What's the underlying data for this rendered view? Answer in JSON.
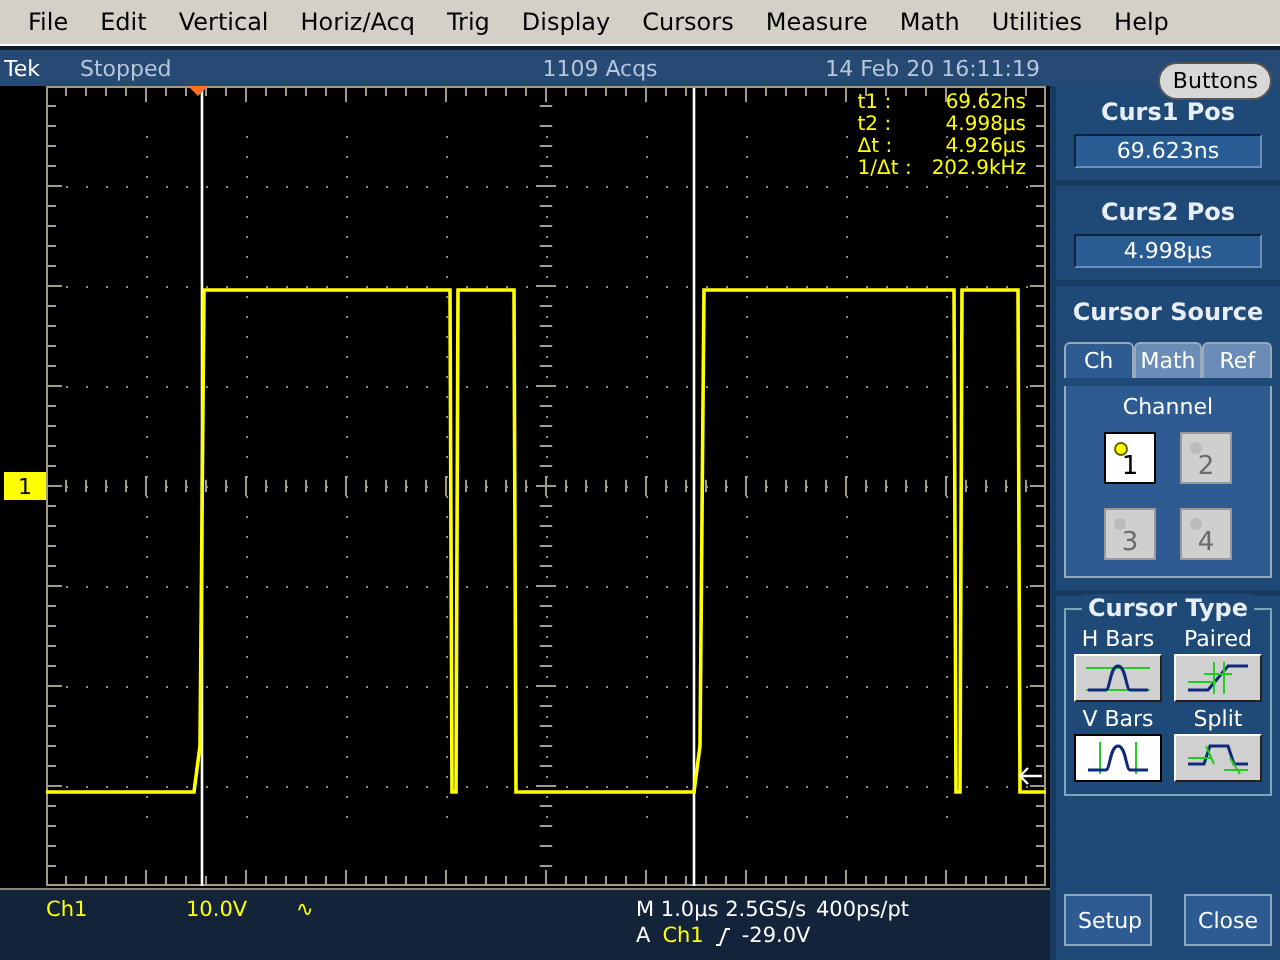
{
  "menu": [
    "File",
    "Edit",
    "Vertical",
    "Horiz/Acq",
    "Trig",
    "Display",
    "Cursors",
    "Measure",
    "Math",
    "Utilities",
    "Help"
  ],
  "status_bar": {
    "brand": "Tek",
    "state": "Stopped",
    "acquisitions": "1109 Acqs",
    "datetime": "14 Feb 20 16:11:19",
    "button": "Buttons"
  },
  "display": {
    "channel_marker": "1",
    "cursor_readouts": [
      {
        "label": "t1 :",
        "value": "69.62ns"
      },
      {
        "label": "t2 :",
        "value": "4.998µs"
      },
      {
        "label": "Δt :",
        "value": "4.926µs"
      },
      {
        "label": "1/Δt :",
        "value": "202.9kHz"
      }
    ]
  },
  "readouts": {
    "channel": "Ch1",
    "scale": "10.0V",
    "coupling": "∿",
    "timebase": "M 1.0µs 2.5GS/s",
    "resolution": "400ps/pt",
    "trigger_mode": "A",
    "trigger_source": "Ch1",
    "trigger_level": "-29.0V"
  },
  "panel": {
    "positions": [
      {
        "title": "Curs1 Pos",
        "value": "69.623ns"
      },
      {
        "title": "Curs2 Pos",
        "value": "4.998µs"
      }
    ],
    "source": {
      "title": "Cursor Source",
      "tabs": [
        {
          "label": "Ch",
          "selected": true
        },
        {
          "label": "Math",
          "selected": false
        },
        {
          "label": "Ref",
          "selected": false
        }
      ],
      "label": "Channel",
      "channels": [
        {
          "label": "1",
          "selected": true
        },
        {
          "label": "2",
          "selected": false
        },
        {
          "label": "3",
          "selected": false
        },
        {
          "label": "4",
          "selected": false
        }
      ]
    },
    "cursor_type": {
      "title": "Cursor Type",
      "options": [
        {
          "label": "H Bars",
          "kind": "hbars",
          "selected": false
        },
        {
          "label": "Paired",
          "kind": "paired",
          "selected": false
        },
        {
          "label": "V Bars",
          "kind": "vbars",
          "selected": true
        },
        {
          "label": "Split",
          "kind": "split",
          "selected": false
        }
      ]
    },
    "buttons": [
      "Setup",
      "Close"
    ]
  }
}
